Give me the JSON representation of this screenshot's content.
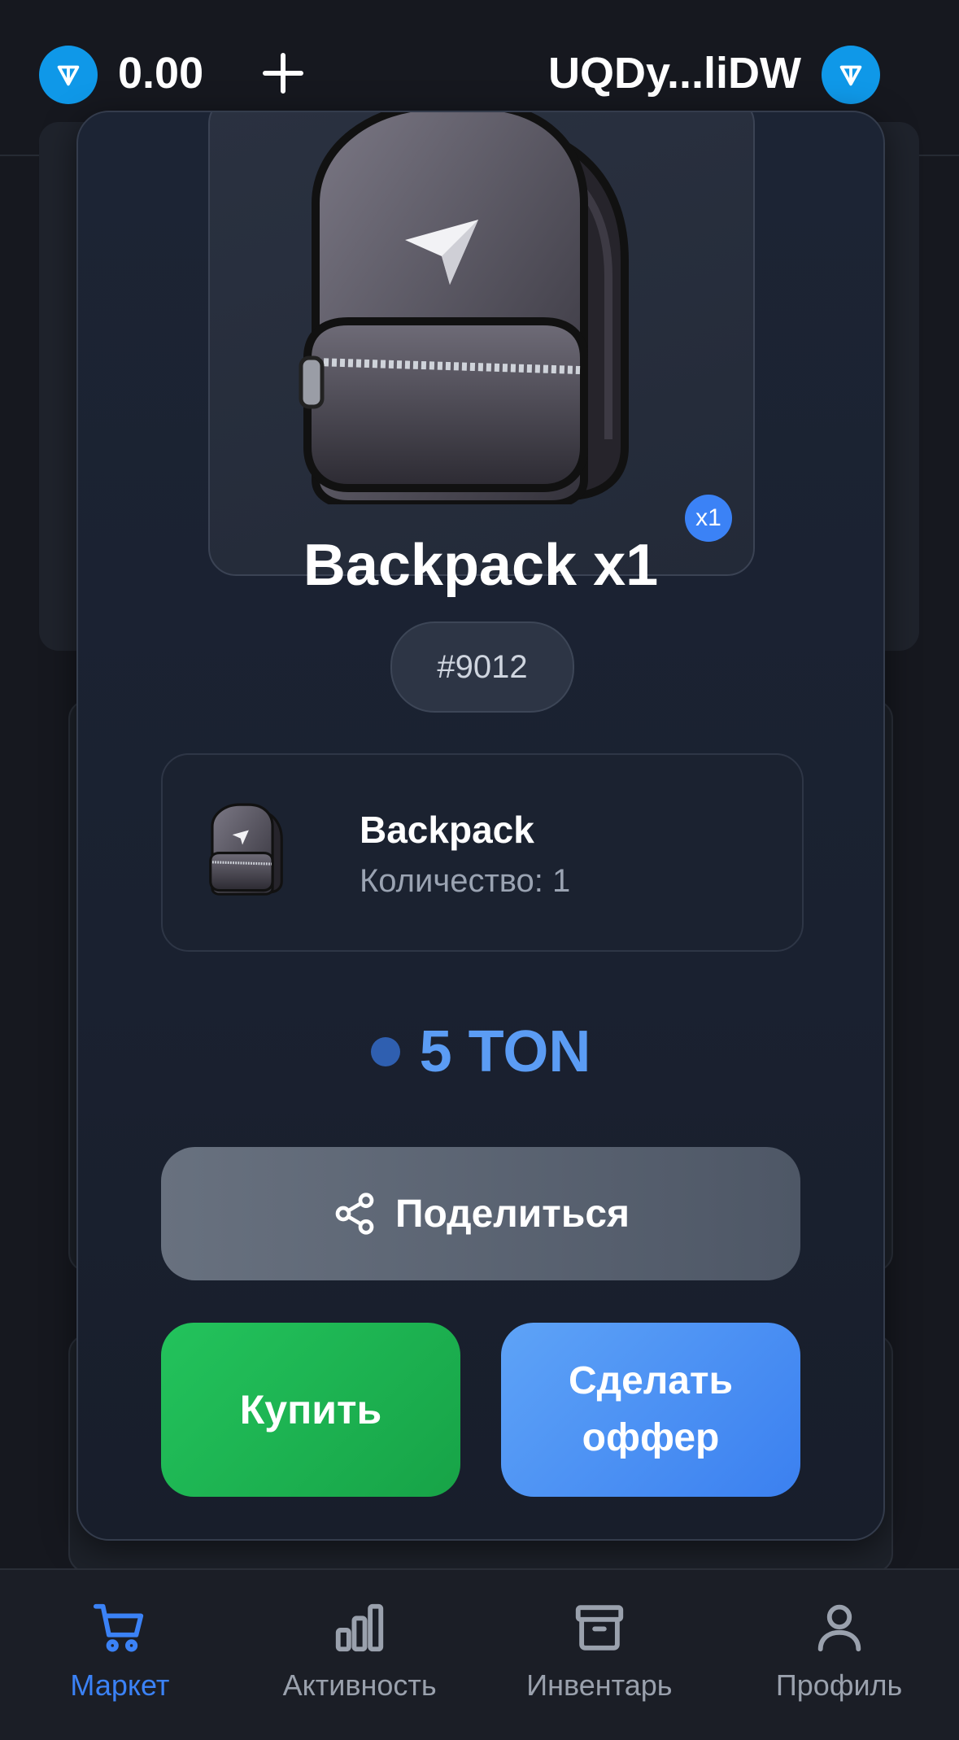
{
  "header": {
    "balance": "0.00",
    "wallet_address": "UQDy...liDW"
  },
  "item": {
    "title": "Backpack x1",
    "quantity_badge": "x1",
    "id": "#9012",
    "name": "Backpack",
    "quantity_text": "Количество: 1",
    "price": "5 TON"
  },
  "actions": {
    "share_label": "Поделиться",
    "buy_label": "Купить",
    "offer_label": "Сделать оффер"
  },
  "nav": {
    "items": [
      {
        "label": "Маркет",
        "icon": "cart-icon",
        "active": true
      },
      {
        "label": "Активность",
        "icon": "bar-chart-icon",
        "active": false
      },
      {
        "label": "Инвентарь",
        "icon": "archive-box-icon",
        "active": false
      },
      {
        "label": "Профиль",
        "icon": "user-icon",
        "active": false
      }
    ]
  },
  "colors": {
    "accent": "#3b82f6",
    "buy": "#22c55e",
    "price": "#5b9cf4",
    "ton": "#0f98e8"
  }
}
